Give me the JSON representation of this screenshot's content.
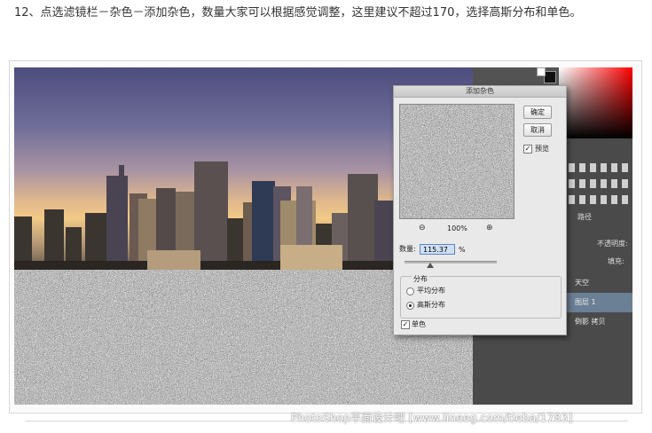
{
  "caption": "12、点选滤镜栏－杂色－添加杂色，数量大家可以根据感觉调整，这里建议不超过170，选择高斯分布和单色。",
  "dialog": {
    "title": "添加杂色",
    "ok_label": "确定",
    "cancel_label": "取消",
    "preview_label": "预览",
    "preview_checked": true,
    "zoom_level": "100%",
    "zoom_out_icon": "zoom-out-icon",
    "zoom_in_icon": "zoom-in-icon",
    "amount_label": "数量:",
    "amount_value": "115.37",
    "amount_unit": "%",
    "distribution_label": "分布",
    "uniform_label": "平均分布",
    "gaussian_label": "高斯分布",
    "selected_distribution": "gaussian",
    "monochrome_label": "单色",
    "monochrome_checked": true
  },
  "panels": {
    "paths_tab": "路径",
    "opacity_label": "不透明度:",
    "fill_label": "填充:",
    "layers": [
      {
        "name": "天空",
        "selected": false
      },
      {
        "name": "图层 1",
        "selected": true
      },
      {
        "name": "倒影 拷贝",
        "selected": false
      }
    ]
  },
  "watermark": "PhotoShop平面设计吧 [www.lineeg.com/tieba/1783]",
  "colors": {
    "dialog_bg": "#e9e9e9",
    "panel_dark": "#4a4a4a",
    "layer_selected": "#6b7f95",
    "amount_field": "#cfe0f7"
  }
}
